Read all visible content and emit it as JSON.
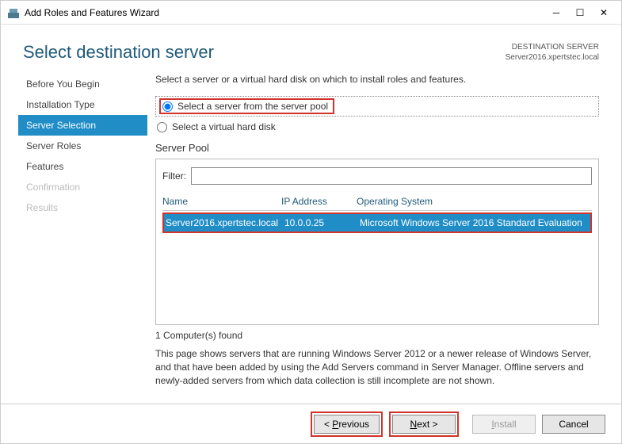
{
  "window": {
    "title": "Add Roles and Features Wizard"
  },
  "header": {
    "title": "Select destination server",
    "meta_label": "DESTINATION SERVER",
    "meta_value": "Server2016.xpertstec.local"
  },
  "sidebar": {
    "items": [
      {
        "label": "Before You Begin",
        "state": "normal"
      },
      {
        "label": "Installation Type",
        "state": "normal"
      },
      {
        "label": "Server Selection",
        "state": "selected"
      },
      {
        "label": "Server Roles",
        "state": "normal"
      },
      {
        "label": "Features",
        "state": "normal"
      },
      {
        "label": "Confirmation",
        "state": "disabled"
      },
      {
        "label": "Results",
        "state": "disabled"
      }
    ]
  },
  "main": {
    "instruction": "Select a server or a virtual hard disk on which to install roles and features.",
    "radio": {
      "opt1": "Select a server from the server pool",
      "opt2": "Select a virtual hard disk"
    },
    "pool_label": "Server Pool",
    "filter_label": "Filter:",
    "filter_value": "",
    "columns": {
      "c1": "Name",
      "c2": "IP Address",
      "c3": "Operating System"
    },
    "rows": [
      {
        "name": "Server2016.xpertstec.local",
        "ip": "10.0.0.25",
        "os": "Microsoft Windows Server 2016 Standard Evaluation"
      }
    ],
    "found": "1 Computer(s) found",
    "description": "This page shows servers that are running Windows Server 2012 or a newer release of Windows Server, and that have been added by using the Add Servers command in Server Manager. Offline servers and newly-added servers from which data collection is still incomplete are not shown."
  },
  "footer": {
    "previous_pre": "< ",
    "previous_u": "P",
    "previous_post": "revious",
    "next_u": "N",
    "next_post": "ext >",
    "install_u": "I",
    "install_post": "nstall",
    "cancel": "Cancel"
  }
}
